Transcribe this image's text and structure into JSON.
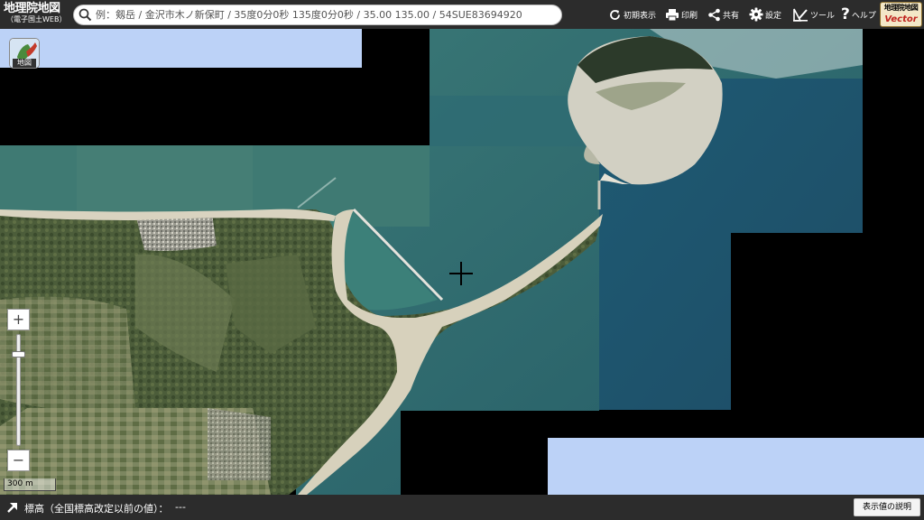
{
  "header": {
    "logo_title": "地理院地図",
    "logo_subtitle": "（電子国土WEB）",
    "search": {
      "placeholder": "例：剱岳 / 金沢市木ノ新保町 / 35度0分0秒 135度0分0秒 / 35.00 135.00 / 54SUE83694920",
      "value": ""
    },
    "tools": [
      {
        "label": "初期表示",
        "icon": "refresh-icon"
      },
      {
        "label": "印刷",
        "icon": "printer-icon"
      },
      {
        "label": "共有",
        "icon": "share-icon"
      },
      {
        "label": "設定",
        "icon": "gear-icon"
      },
      {
        "label": "ツール",
        "icon": "tools-icon"
      },
      {
        "label": "ヘルプ",
        "icon": "help-icon"
      }
    ],
    "vector_badge": {
      "line1": "地理院地図",
      "line2": "Vector"
    }
  },
  "map": {
    "basemap_button_label": "地図",
    "zoom_in": "+",
    "zoom_out": "−",
    "scale_label": "300 m",
    "crosshair_icon": "crosshair-icon",
    "background_color": "#000000",
    "base_blue_color": "#bcd2f7",
    "sea_color": "#2f6a6a",
    "land_color": "#6d7f58"
  },
  "footer": {
    "elevation_label": "標高（全国標高改定以前の値）：",
    "elevation_value": "---",
    "legend_button": "表示値の説明"
  }
}
